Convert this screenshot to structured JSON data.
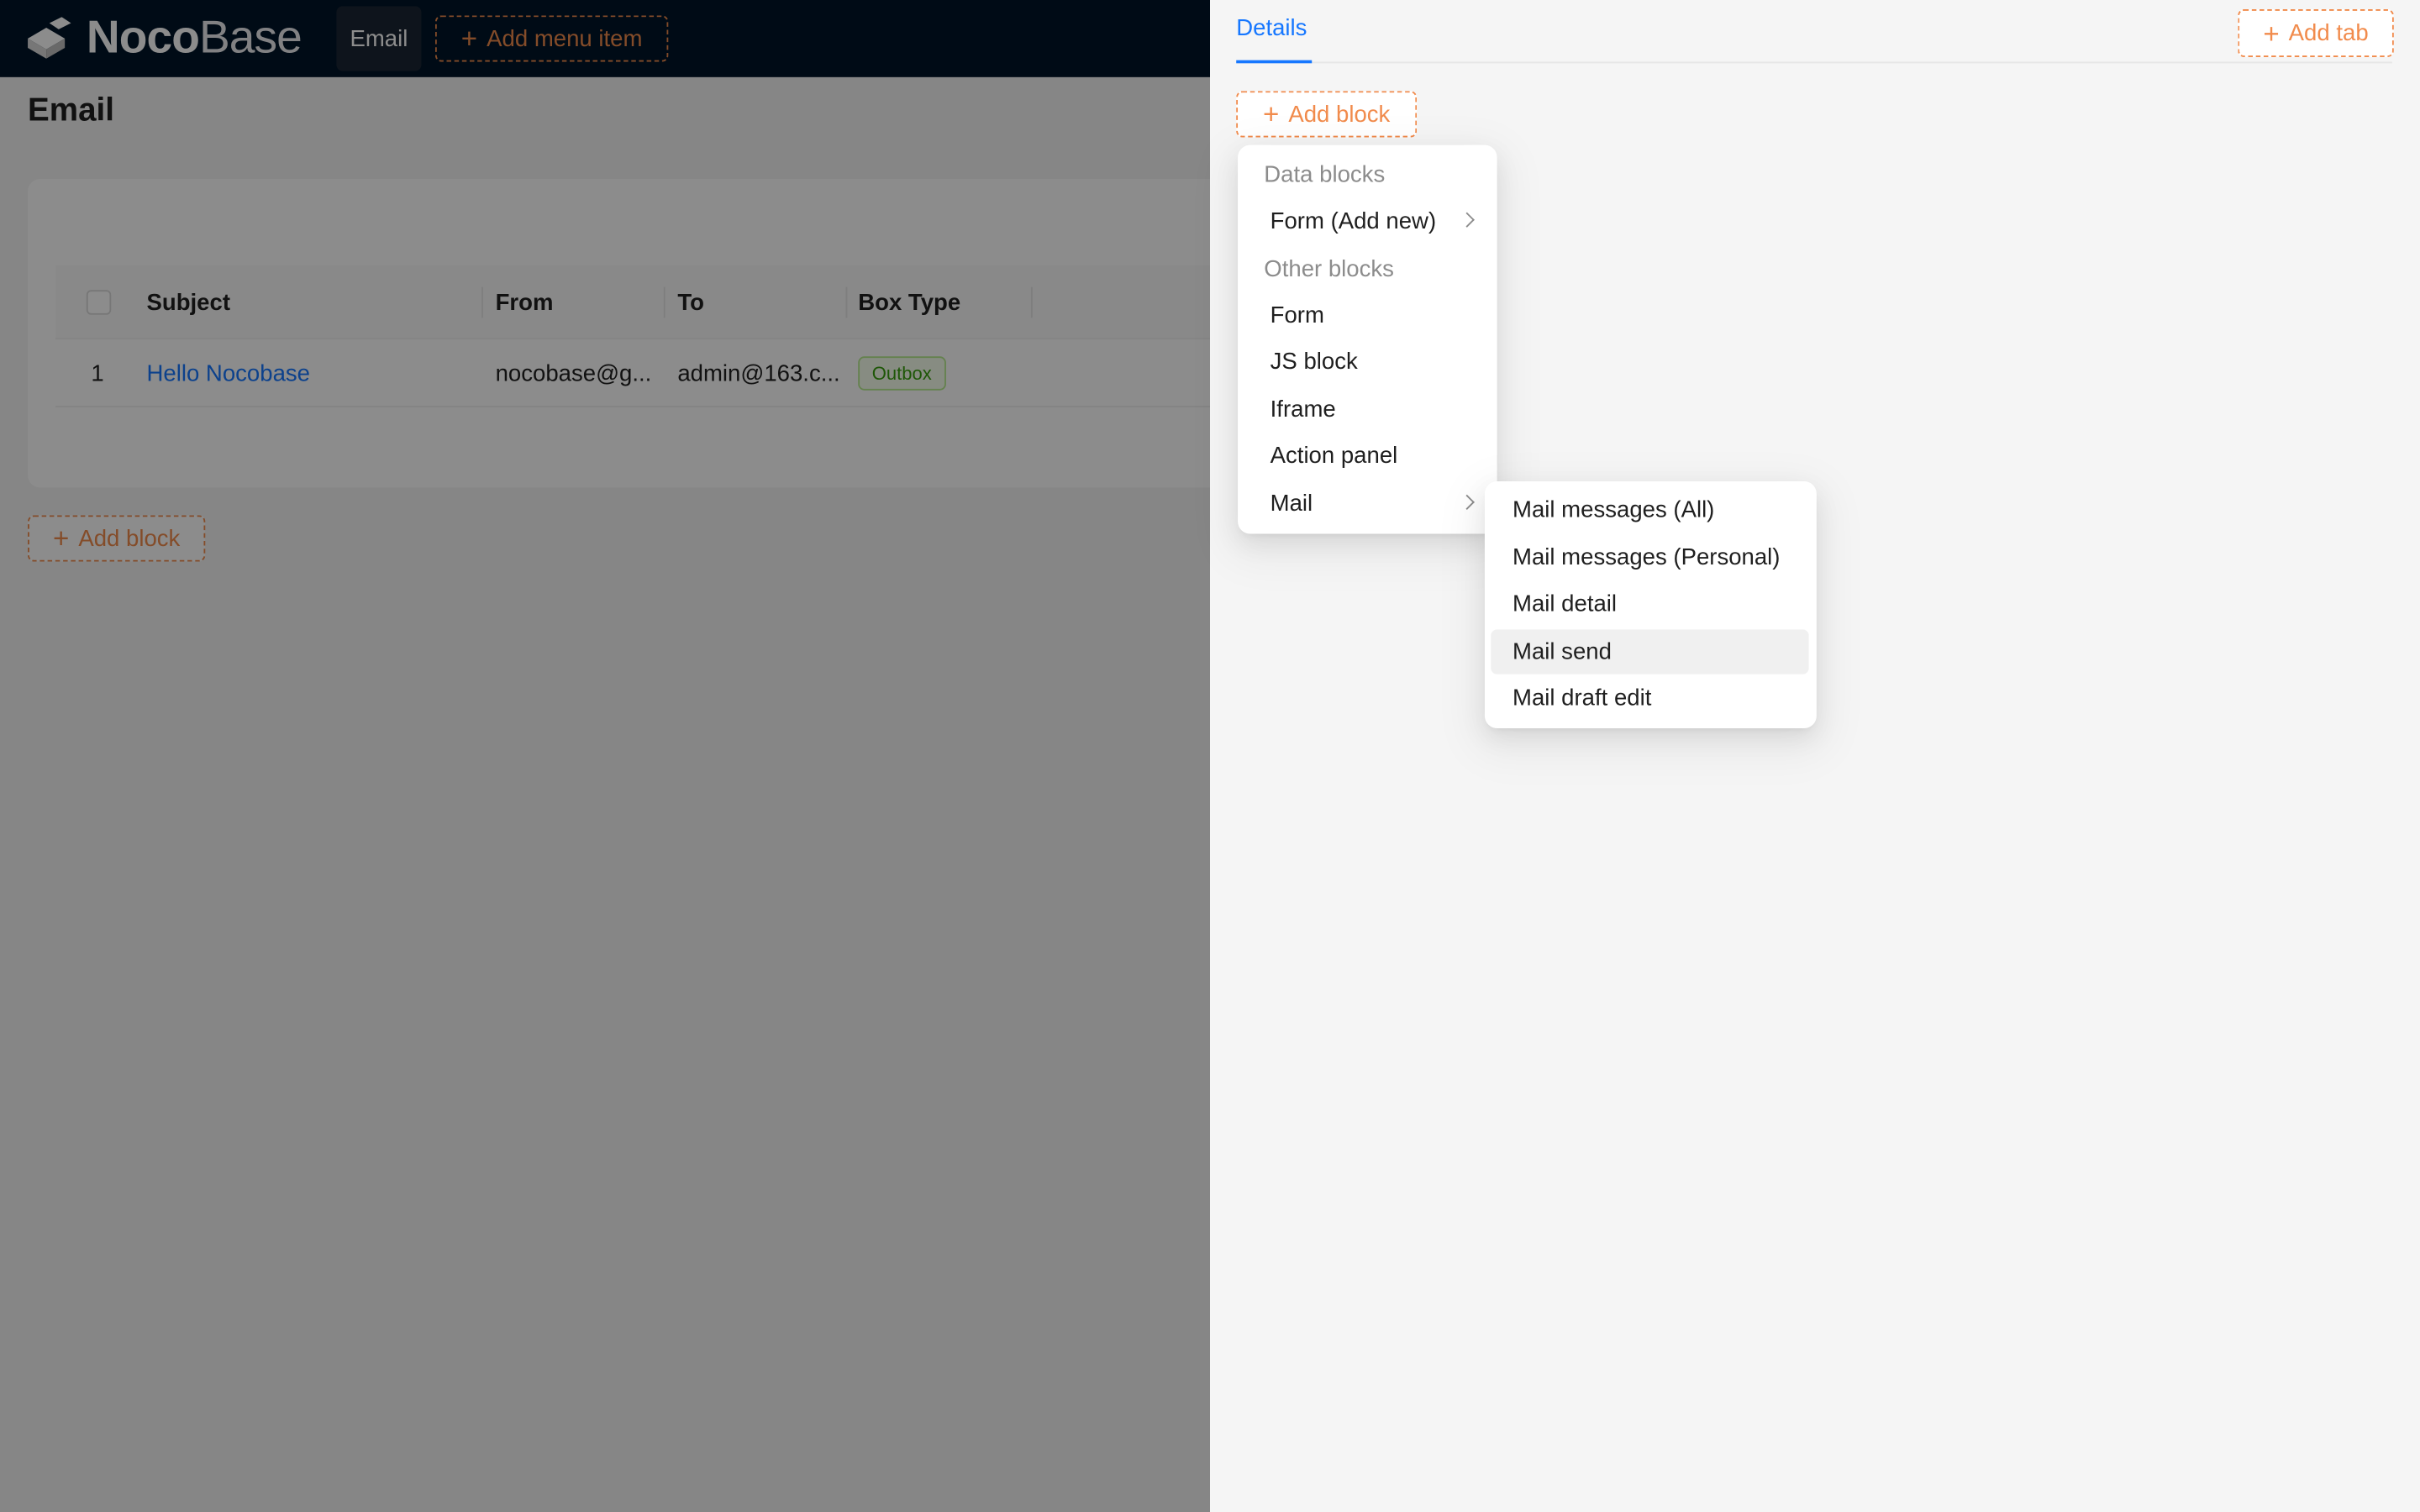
{
  "brand": {
    "name_bold": "Noco",
    "name_light": "Base"
  },
  "topnav": {
    "email_label": "Email",
    "add_menu_item_label": "Add menu item"
  },
  "page": {
    "title": "Email",
    "table": {
      "columns": [
        "Subject",
        "From",
        "To",
        "Box Type"
      ],
      "rows": [
        {
          "index": "1",
          "subject": "Hello Nocobase",
          "from": "nocobase@g...",
          "to": "admin@163.c...",
          "box_type": "Outbox"
        }
      ]
    },
    "add_block_label": "Add block"
  },
  "drawer": {
    "tab_label": "Details",
    "add_tab_label": "Add tab",
    "add_block_label": "Add block"
  },
  "block_menu": {
    "data_blocks_title": "Data blocks",
    "form_add_new": "Form (Add new)",
    "other_blocks_title": "Other blocks",
    "form": "Form",
    "js_block": "JS block",
    "iframe": "Iframe",
    "action_panel": "Action panel",
    "mail": "Mail"
  },
  "mail_submenu": {
    "items": [
      "Mail messages (All)",
      "Mail messages (Personal)",
      "Mail detail",
      "Mail send",
      "Mail draft edit"
    ],
    "highlighted": "Mail send"
  },
  "colors": {
    "accent": "#f18b4c",
    "link": "#1677ff",
    "topbar": "#001529"
  }
}
